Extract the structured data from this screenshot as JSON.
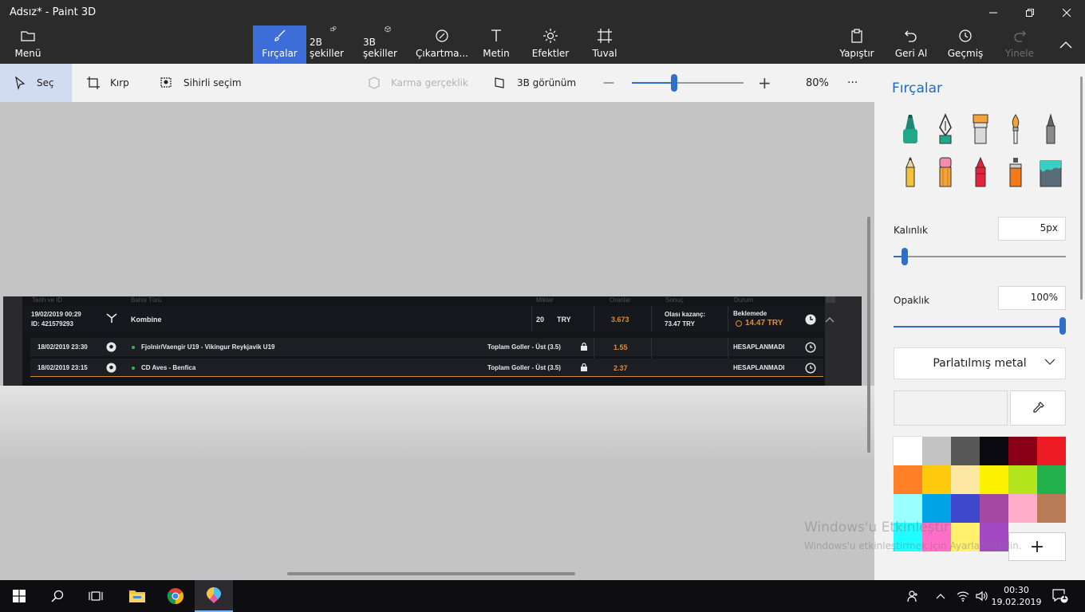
{
  "window": {
    "title": "Adsız* - Paint 3D"
  },
  "ribbon": {
    "menu": "Menü",
    "tabs": [
      "Fırçalar",
      "2B şekiller",
      "3B şekiller",
      "Çıkartma...",
      "Metin",
      "Efektler",
      "Tuval"
    ],
    "active_tab": "Fırçalar",
    "right": [
      "Yapıştır",
      "Geri Al",
      "Geçmiş",
      "Yinele"
    ]
  },
  "toolbar": {
    "select": "Seç",
    "crop": "Kırp",
    "magic_select": "Sihirli seçim",
    "mixed_reality": "Karma gerçeklik",
    "view_3d": "3B görünüm",
    "zoom_minus": "—",
    "zoom_plus": "+",
    "zoom_level": "80%",
    "zoom_fraction": 0.37,
    "more": "···"
  },
  "panel": {
    "title": "Fırçalar",
    "brushes": [
      "marker-icon",
      "calligraphy-pen-icon",
      "oil-brush-icon",
      "watercolor-icon",
      "pixel-pen-icon",
      "pencil-icon",
      "eraser-icon",
      "crayon-icon",
      "spray-can-icon",
      "fill-icon"
    ],
    "thickness_label": "Kalınlık",
    "thickness_value": "5px",
    "thickness_fraction": 0.05,
    "opacity_label": "Opaklık",
    "opacity_value": "100%",
    "opacity_fraction": 1.0,
    "material": "Parlatılmış metal",
    "add_color": "+",
    "colors": [
      "#ffffff",
      "#c3c3c3",
      "#585858",
      "#0a0a10",
      "#880015",
      "#ed1c24",
      "#ff7f27",
      "#ffc90e",
      "#fde9a3",
      "#fff200",
      "#b5e61d",
      "#22b14c",
      "#99ffff",
      "#00a2e8",
      "#3f48cc",
      "#a349a4",
      "#ffaec9",
      "#b97a57",
      "#20ffff",
      "#ff6ec7",
      "#fff06d",
      "#a349c4"
    ]
  },
  "screenshot": {
    "headers": [
      "Tarih ve ID",
      "Bahis Türü",
      "Miktar",
      "Oranlar",
      "Sonuç",
      "Durum"
    ],
    "bet": {
      "date": "19/02/2019 00:29",
      "id": "ID: 421579293",
      "type": "Kombine",
      "amount": "20",
      "currency": "TRY",
      "odds": "3.673",
      "potential_label": "Olası kazanç:",
      "potential": "73.47 TRY",
      "status": "Beklemede",
      "cashout": "14.47 TRY"
    },
    "events": [
      {
        "date": "18/02/2019 23:30",
        "match": "Fjolnir/Vaengir U19 - Vikingur Reykjavik U19",
        "market": "Toplam Goller - Üst (3.5)",
        "odds": "1.55",
        "status": "HESAPLANMADI"
      },
      {
        "date": "18/02/2019 23:15",
        "match": "CD Aves - Benfica",
        "market": "Toplam Goller - Üst (3.5)",
        "odds": "2.37",
        "status": "HESAPLANMADI"
      }
    ]
  },
  "watermark": {
    "line1": "Windows'u Etkinleştir",
    "line2": "Windows'u etkinleştirmek için Ayarlar'a gidin."
  },
  "taskbar": {
    "time": "00:30",
    "date": "19.02.2019",
    "notifications": "1"
  }
}
